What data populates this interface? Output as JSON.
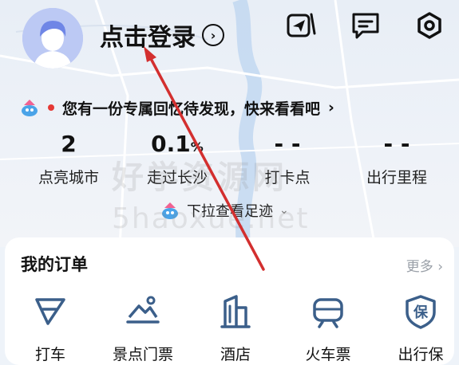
{
  "header": {
    "login_label": "点击登录",
    "chevron": "›"
  },
  "top_icons": [
    "send-icon",
    "message-icon",
    "settings-icon"
  ],
  "promo": {
    "text": "您有一份专属回忆待发现，快来看看吧",
    "chevron": "›"
  },
  "stats": [
    {
      "value": "2",
      "suffix": "",
      "label": "点亮城市"
    },
    {
      "value": "0.1",
      "suffix": "%",
      "label": "走过长沙"
    },
    {
      "value": "- -",
      "suffix": "",
      "label": "打卡点"
    },
    {
      "value": "- -",
      "suffix": "",
      "label": "出行里程"
    }
  ],
  "pulldown": {
    "text": "下拉查看足迹",
    "chevron": "⌄"
  },
  "orders": {
    "title": "我的订单",
    "more": "更多 ›",
    "services": [
      {
        "label": "打车",
        "icon": "taxi-icon"
      },
      {
        "label": "景点门票",
        "icon": "scenic-ticket-icon"
      },
      {
        "label": "酒店",
        "icon": "hotel-icon"
      },
      {
        "label": "火车票",
        "icon": "train-icon"
      },
      {
        "label": "出行保",
        "icon": "insurance-icon"
      }
    ]
  },
  "watermark": {
    "cn": "好学资源网",
    "en": "5haoxue.net"
  },
  "colors": {
    "accent": "#2b6ce5",
    "arrow": "#d32f2f",
    "avatar": "#bcc9f4"
  }
}
